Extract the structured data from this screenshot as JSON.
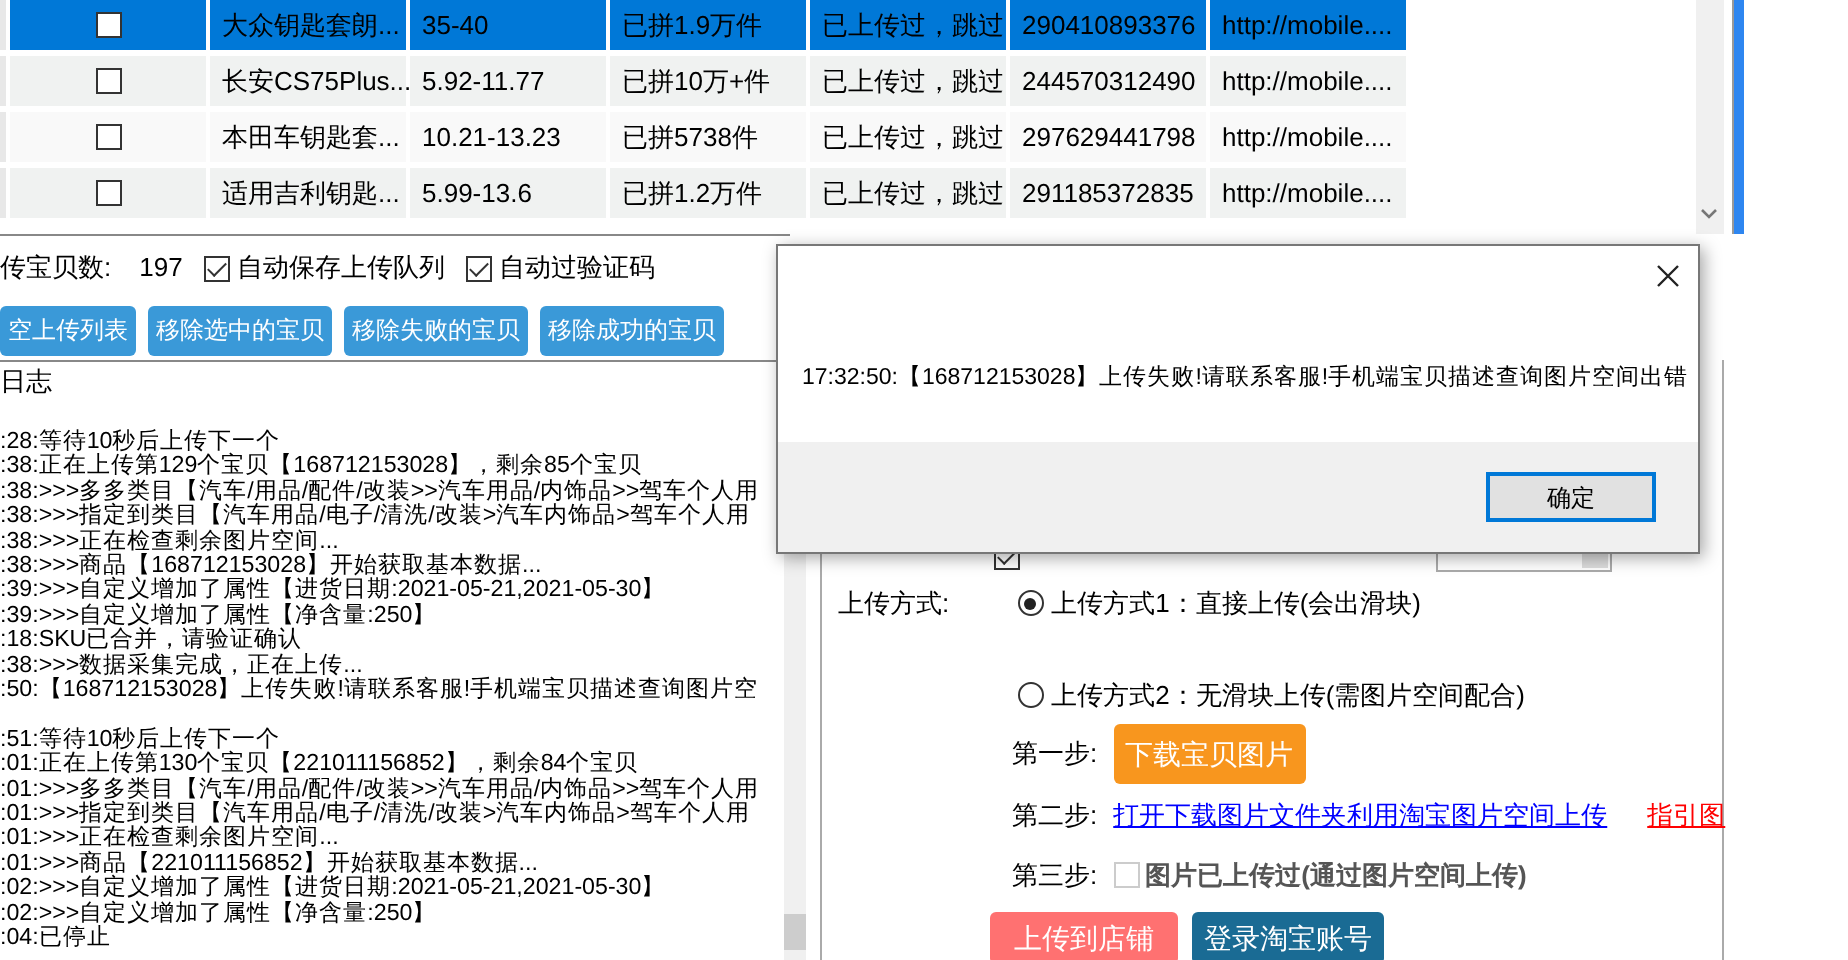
{
  "table": {
    "rows": [
      {
        "selected": true,
        "checked": false,
        "cells": [
          "大众钥匙套朗...",
          "35-40",
          "已拼1.9万件",
          "已上传过，跳过",
          "290410893376",
          "http://mobile...."
        ]
      },
      {
        "selected": false,
        "checked": false,
        "cells": [
          "长安CS75Plus...",
          "5.92-11.77",
          "已拼10万+件",
          "已上传过，跳过",
          "244570312490",
          "http://mobile...."
        ]
      },
      {
        "selected": false,
        "checked": false,
        "cells": [
          "本田车钥匙套...",
          "10.21-13.23",
          "已拼5738件",
          "已上传过，跳过",
          "297629441798",
          "http://mobile...."
        ]
      },
      {
        "selected": false,
        "checked": false,
        "cells": [
          "适用吉利钥匙...",
          "5.99-13.6",
          "已拼1.2万件",
          "已上传过，跳过",
          "291185372835",
          "http://mobile...."
        ]
      }
    ]
  },
  "queue": {
    "count_label": "传宝贝数:",
    "count": "197",
    "options": [
      {
        "label": "自动保存上传队列",
        "checked": true
      },
      {
        "label": "自动过验证码",
        "checked": true
      }
    ],
    "buttons": [
      "空上传列表",
      "移除选中的宝贝",
      "移除失败的宝贝",
      "移除成功的宝贝"
    ]
  },
  "log": {
    "title": "日志",
    "blocks": [
      [
        ":28:等待10秒后上传下一个",
        ":38:正在上传第129个宝贝【168712153028】，剩余85个宝贝",
        ":38:>>>多多类目【汽车/用品/配件/改装>>汽车用品/内饰品>>驾车个人用",
        ":38:>>>指定到类目【汽车用品/电子/清洗/改装>汽车内饰品>驾车个人用",
        ":38:>>>正在检查剩余图片空间...",
        ":38:>>>商品【168712153028】开始获取基本数据...",
        ":39:>>>自定义增加了属性【进货日期:2021-05-21,2021-05-30】",
        ":39:>>>自定义增加了属性【净含量:250】",
        ":18:SKU已合并，请验证确认",
        ":38:>>>数据采集完成，正在上传...",
        ":50:【168712153028】上传失败!请联系客服!手机端宝贝描述查询图片空"
      ],
      [
        ":51:等待10秒后上传下一个",
        ":01:正在上传第130个宝贝【221011156852】，剩余84个宝贝",
        ":01:>>>多多类目【汽车/用品/配件/改装>>汽车用品/内饰品>>驾车个人用",
        ":01:>>>指定到类目【汽车用品/电子/清洗/改装>汽车内饰品>驾车个人用",
        ":01:>>>正在检查剩余图片空间...",
        ":01:>>>商品【221011156852】开始获取基本数据...",
        ":02:>>>自定义增加了属性【进货日期:2021-05-21,2021-05-30】",
        ":02:>>>自定义增加了属性【净含量:250】",
        ":04:已停止"
      ]
    ]
  },
  "upload": {
    "force_checked": true,
    "method_label": "上传方式:",
    "methods": [
      {
        "label": "上传方式1：直接上传(会出滑块)",
        "selected": true
      },
      {
        "label": "上传方式2：无滑块上传(需图片空间配合)",
        "selected": false
      }
    ],
    "steps": [
      {
        "kind": "button",
        "label": "第一步:",
        "text": "下载宝贝图片"
      },
      {
        "kind": "links",
        "label": "第二步:",
        "links": [
          {
            "text": "打开下载图片文件夹利用淘宝图片空间上传",
            "color": "#0000ff"
          },
          {
            "text": "指引图",
            "color": "#ff0000"
          }
        ]
      },
      {
        "kind": "checkbox",
        "label": "第三步:",
        "text": "图片已上传过(通过图片空间上传)",
        "checked": false
      }
    ],
    "actions": [
      {
        "label": "上传到店铺",
        "color": "#ff7171"
      },
      {
        "label": "登录淘宝账号",
        "color": "#1a6b94"
      }
    ]
  },
  "dialog": {
    "message": "17:32:50:【168712153028】上传失败!请联系客服!手机端宝贝描述查询图片空间出错",
    "ok": "确定"
  }
}
